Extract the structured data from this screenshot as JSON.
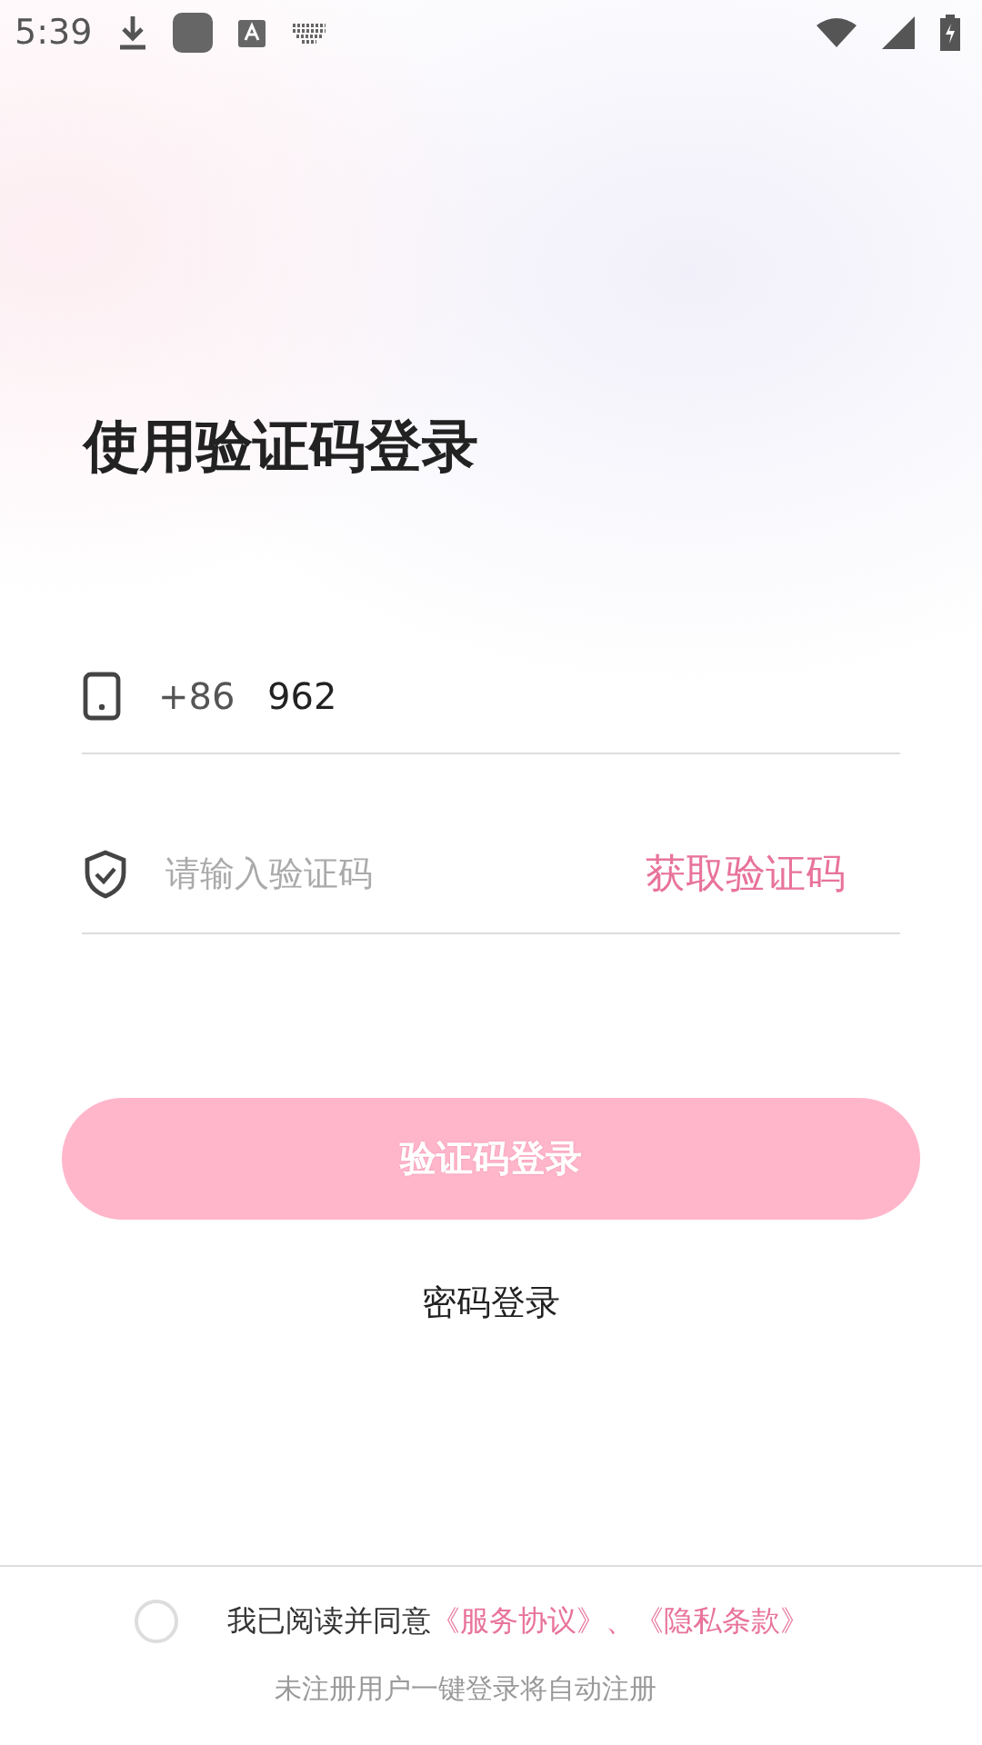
{
  "status_bar": {
    "time": "5:39"
  },
  "title": "使用验证码登录",
  "phone_field": {
    "country_code": "+86",
    "value": "962"
  },
  "code_field": {
    "placeholder": "请输入验证码",
    "action": "获取验证码"
  },
  "login_button": {
    "label": "验证码登录",
    "disabled": true
  },
  "password_login": "密码登录",
  "agreement": {
    "checked": false,
    "text": "我已阅读并同意",
    "links": [
      "《服务协议》",
      "《隐私条款》"
    ],
    "separator": "、"
  },
  "note": "未注册用户一键登录将自动注册"
}
